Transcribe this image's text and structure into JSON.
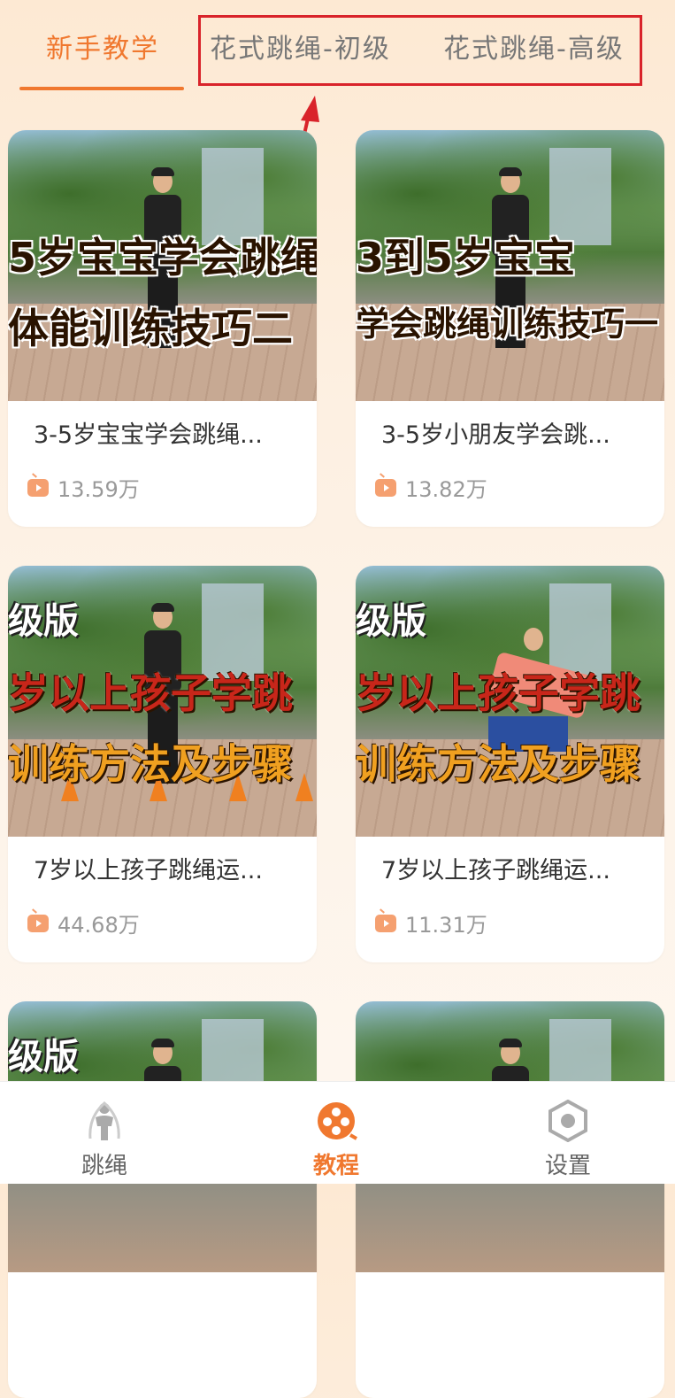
{
  "tabs": [
    {
      "label": "新手教学",
      "active": true
    },
    {
      "label": "花式跳绳-初级",
      "active": false
    },
    {
      "label": "花式跳绳-高级",
      "active": false
    }
  ],
  "accent_color": "#f0782f",
  "annotation_color": "#d9232a",
  "videos": [
    {
      "title": "3-5岁宝宝学会跳绳...",
      "views": "13.59万",
      "thumb_lines": [
        "5岁宝宝学会跳绳",
        "体能训练技巧二"
      ]
    },
    {
      "title": "3-5岁小朋友学会跳...",
      "views": "13.82万",
      "thumb_lines": [
        "3到5岁宝宝",
        "学会跳绳训练技巧一"
      ]
    },
    {
      "title": "7岁以上孩子跳绳运...",
      "views": "44.68万",
      "thumb_tag": "级版",
      "thumb_lines": [
        "岁以上孩子学跳",
        "训练方法及步骤"
      ]
    },
    {
      "title": "7岁以上孩子跳绳运...",
      "views": "11.31万",
      "thumb_tag": "级版",
      "thumb_lines": [
        "岁以上孩子学跳",
        "训练方法及步骤"
      ]
    },
    {
      "thumb_tag": "级版"
    },
    {}
  ],
  "bottom_nav": [
    {
      "label": "跳绳",
      "icon": "jump-rope-person-icon",
      "active": false
    },
    {
      "label": "教程",
      "icon": "film-reel-icon",
      "active": true
    },
    {
      "label": "设置",
      "icon": "hex-gear-icon",
      "active": false
    }
  ]
}
